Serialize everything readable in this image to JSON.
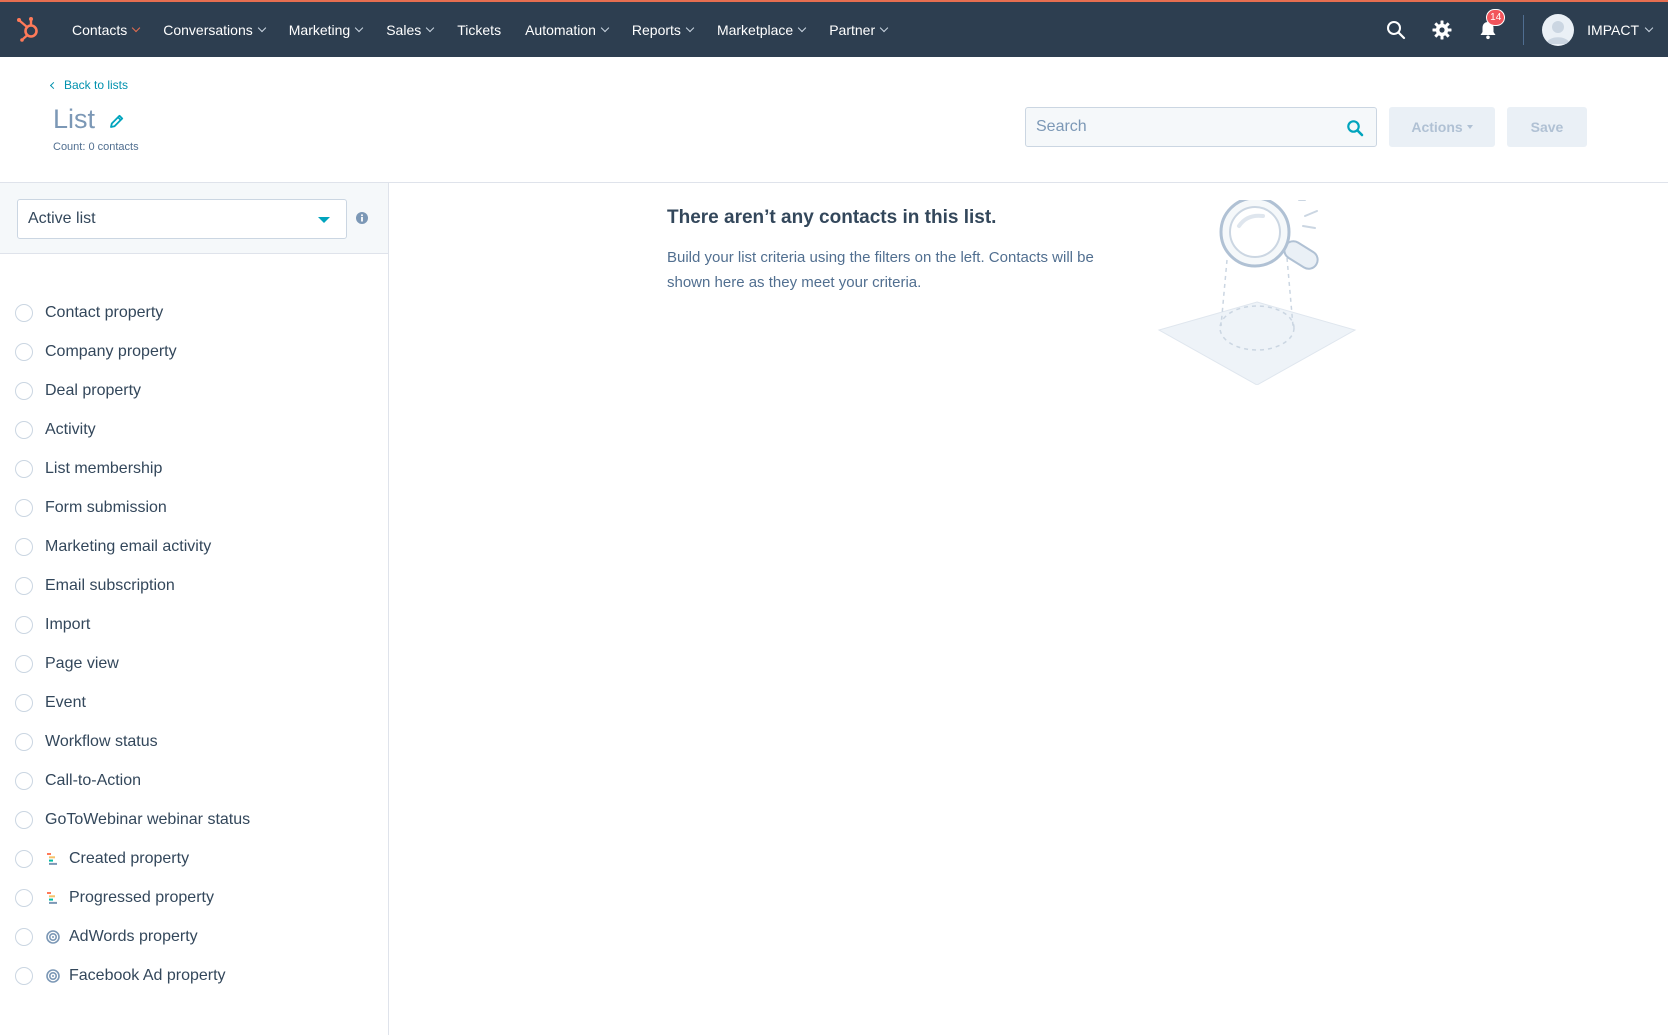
{
  "nav": {
    "items": [
      {
        "label": "Contacts",
        "has_menu": true,
        "active": true
      },
      {
        "label": "Conversations",
        "has_menu": true
      },
      {
        "label": "Marketing",
        "has_menu": true
      },
      {
        "label": "Sales",
        "has_menu": true
      },
      {
        "label": "Tickets",
        "has_menu": false
      },
      {
        "label": "Automation",
        "has_menu": true
      },
      {
        "label": "Reports",
        "has_menu": true
      },
      {
        "label": "Marketplace",
        "has_menu": true
      },
      {
        "label": "Partner",
        "has_menu": true
      }
    ],
    "notifications_count": "14",
    "account_name": "IMPACT"
  },
  "header": {
    "back_label": "Back to lists",
    "title": "List",
    "count": "Count: 0 contacts",
    "search_placeholder": "Search",
    "actions_label": "Actions",
    "save_label": "Save"
  },
  "left": {
    "list_type": "Active list",
    "filters": [
      {
        "label": "Contact property",
        "icon": ""
      },
      {
        "label": "Company property",
        "icon": ""
      },
      {
        "label": "Deal property",
        "icon": ""
      },
      {
        "label": "Activity",
        "icon": ""
      },
      {
        "label": "List membership",
        "icon": ""
      },
      {
        "label": "Form submission",
        "icon": ""
      },
      {
        "label": "Marketing email activity",
        "icon": ""
      },
      {
        "label": "Email subscription",
        "icon": ""
      },
      {
        "label": "Import",
        "icon": ""
      },
      {
        "label": "Page view",
        "icon": ""
      },
      {
        "label": "Event",
        "icon": ""
      },
      {
        "label": "Workflow status",
        "icon": ""
      },
      {
        "label": "Call-to-Action",
        "icon": ""
      },
      {
        "label": "GoToWebinar webinar status",
        "icon": ""
      },
      {
        "label": "Created property",
        "icon": "bars-icon"
      },
      {
        "label": "Progressed property",
        "icon": "bars-icon"
      },
      {
        "label": "AdWords property",
        "icon": "target-icon"
      },
      {
        "label": "Facebook Ad property",
        "icon": "target-icon"
      }
    ]
  },
  "empty_state": {
    "title": "There aren’t any contacts in this list.",
    "text": "Build your list criteria using the filters on the left. Contacts will be shown here as they meet your criteria."
  },
  "colors": {
    "nav_bg": "#2d3e50",
    "accent": "#00a4bd",
    "brand": "#ff7a59",
    "badge": "#f2545b"
  }
}
